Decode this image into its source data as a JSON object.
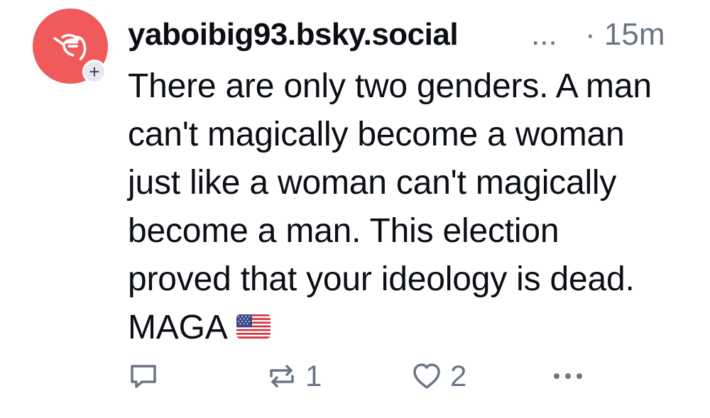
{
  "post": {
    "author": {
      "handle": "yaboibig93.bsky.social",
      "handle_truncation": "...",
      "avatar_icon": "shaka-hand-icon",
      "avatar_color": "#f05a5a",
      "follow_badge": "+"
    },
    "timestamp": "· 15m",
    "text": "There are only two genders. A man can't magically become a woman just like a woman can't magically become a man. This election proved that your ideology is dead. MAGA",
    "emoji": "us-flag-icon",
    "actions": {
      "reply": {
        "icon": "reply-icon",
        "count": ""
      },
      "repost": {
        "icon": "repost-icon",
        "count": "1"
      },
      "like": {
        "icon": "heart-icon",
        "count": "2"
      },
      "more": {
        "icon": "more-icon"
      }
    },
    "colors": {
      "text": "#0b0f14",
      "muted": "#6b7584"
    }
  }
}
